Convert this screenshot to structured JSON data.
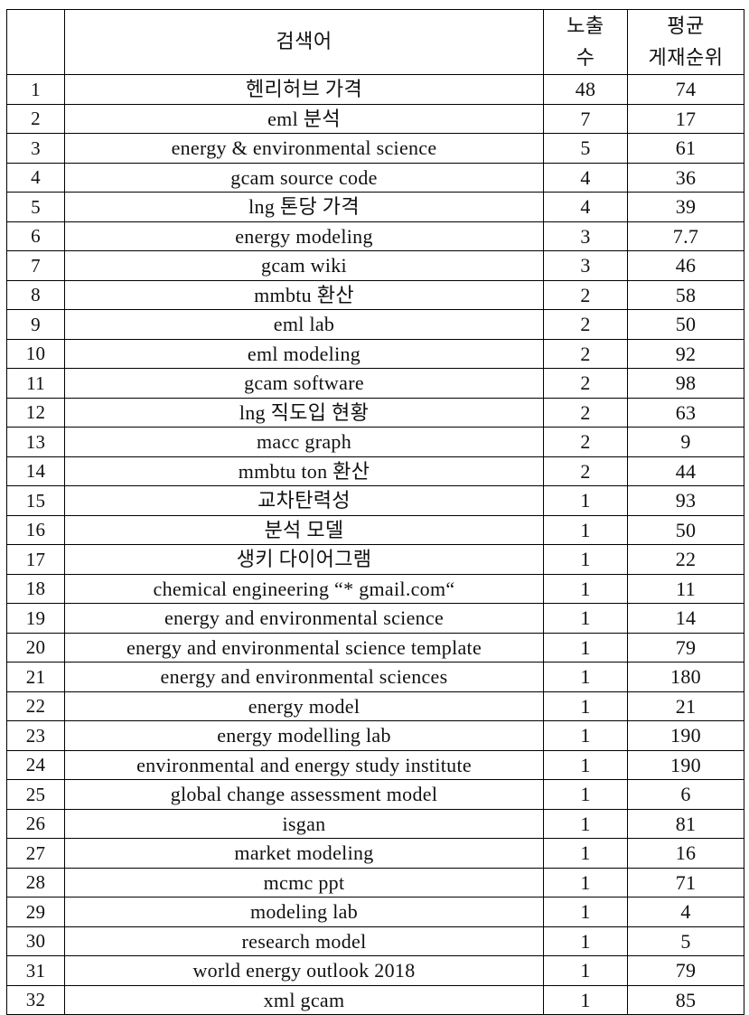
{
  "table": {
    "headers": {
      "index": "",
      "term": "검색어",
      "impressions_line1": "노출",
      "impressions_line2": "수",
      "rank_line1": "평균",
      "rank_line2": "게재순위"
    },
    "rows": [
      {
        "index": "1",
        "term": "헨리허브 가격",
        "impressions": "48",
        "rank": "74"
      },
      {
        "index": "2",
        "term": "eml 분석",
        "impressions": "7",
        "rank": "17"
      },
      {
        "index": "3",
        "term": "energy & environmental science",
        "impressions": "5",
        "rank": "61"
      },
      {
        "index": "4",
        "term": "gcam source code",
        "impressions": "4",
        "rank": "36"
      },
      {
        "index": "5",
        "term": "lng 톤당 가격",
        "impressions": "4",
        "rank": "39"
      },
      {
        "index": "6",
        "term": "energy modeling",
        "impressions": "3",
        "rank": "7.7"
      },
      {
        "index": "7",
        "term": "gcam wiki",
        "impressions": "3",
        "rank": "46"
      },
      {
        "index": "8",
        "term": "mmbtu 환산",
        "impressions": "2",
        "rank": "58"
      },
      {
        "index": "9",
        "term": "eml lab",
        "impressions": "2",
        "rank": "50"
      },
      {
        "index": "10",
        "term": "eml modeling",
        "impressions": "2",
        "rank": "92"
      },
      {
        "index": "11",
        "term": "gcam software",
        "impressions": "2",
        "rank": "98"
      },
      {
        "index": "12",
        "term": "lng 직도입 현황",
        "impressions": "2",
        "rank": "63"
      },
      {
        "index": "13",
        "term": "macc graph",
        "impressions": "2",
        "rank": "9"
      },
      {
        "index": "14",
        "term": "mmbtu ton 환산",
        "impressions": "2",
        "rank": "44"
      },
      {
        "index": "15",
        "term": "교차탄력성",
        "impressions": "1",
        "rank": "93"
      },
      {
        "index": "16",
        "term": "분석 모델",
        "impressions": "1",
        "rank": "50"
      },
      {
        "index": "17",
        "term": "생키 다이어그램",
        "impressions": "1",
        "rank": "22"
      },
      {
        "index": "18",
        "term": "chemical engineering “* gmail.com“",
        "impressions": "1",
        "rank": "11"
      },
      {
        "index": "19",
        "term": "energy and environmental science",
        "impressions": "1",
        "rank": "14"
      },
      {
        "index": "20",
        "term": "energy and environmental science template",
        "impressions": "1",
        "rank": "79"
      },
      {
        "index": "21",
        "term": "energy and environmental sciences",
        "impressions": "1",
        "rank": "180"
      },
      {
        "index": "22",
        "term": "energy model",
        "impressions": "1",
        "rank": "21"
      },
      {
        "index": "23",
        "term": "energy modelling lab",
        "impressions": "1",
        "rank": "190"
      },
      {
        "index": "24",
        "term": "environmental and energy study institute",
        "impressions": "1",
        "rank": "190"
      },
      {
        "index": "25",
        "term": "global change assessment model",
        "impressions": "1",
        "rank": "6"
      },
      {
        "index": "26",
        "term": "isgan",
        "impressions": "1",
        "rank": "81"
      },
      {
        "index": "27",
        "term": "market modeling",
        "impressions": "1",
        "rank": "16"
      },
      {
        "index": "28",
        "term": "mcmc ppt",
        "impressions": "1",
        "rank": "71"
      },
      {
        "index": "29",
        "term": "modeling lab",
        "impressions": "1",
        "rank": "4"
      },
      {
        "index": "30",
        "term": "research model",
        "impressions": "1",
        "rank": "5"
      },
      {
        "index": "31",
        "term": "world energy outlook 2018",
        "impressions": "1",
        "rank": "79"
      },
      {
        "index": "32",
        "term": "xml gcam",
        "impressions": "1",
        "rank": "85"
      }
    ]
  },
  "colors": {
    "border": "#000000",
    "text": "#111111",
    "background": "#ffffff"
  }
}
